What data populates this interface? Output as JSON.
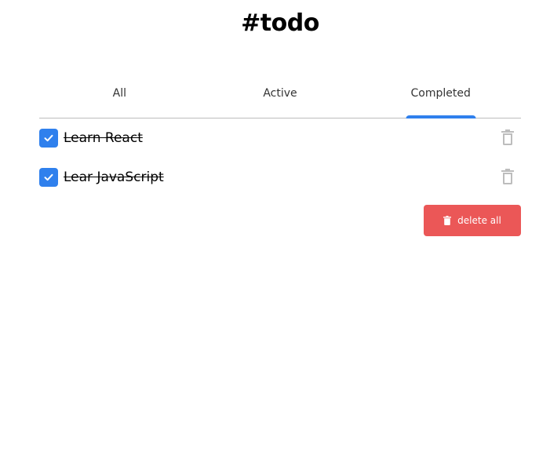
{
  "app": {
    "title": "#todo"
  },
  "tabs": [
    {
      "label": "All",
      "active": false
    },
    {
      "label": "Active",
      "active": false
    },
    {
      "label": "Completed",
      "active": true
    }
  ],
  "todos": [
    {
      "text": "Learn React",
      "completed": true
    },
    {
      "text": "Lear JavaScript",
      "completed": true
    }
  ],
  "actions": {
    "delete_all_label": "delete all"
  },
  "icons": {
    "checkbox": "check-icon",
    "item_delete": "trash-icon",
    "delete_all": "trash-icon"
  },
  "colors": {
    "accent": "#2f80ed",
    "danger": "#eb5757",
    "muted_icon": "#bdbdbd",
    "divider": "#bdbdbd"
  }
}
